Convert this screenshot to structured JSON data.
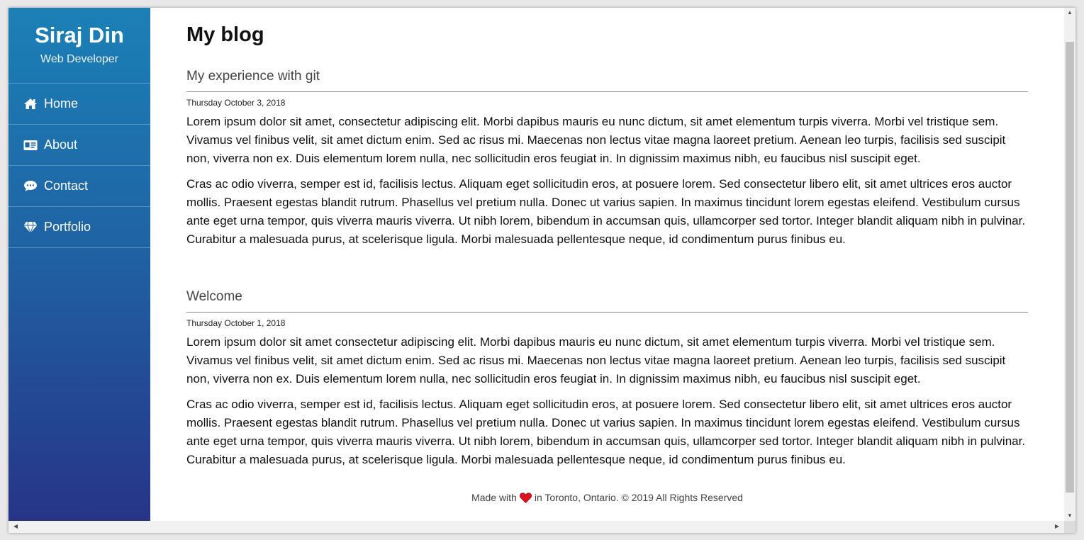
{
  "brand": {
    "name": "Siraj Din",
    "role": "Web Developer"
  },
  "nav": {
    "items": [
      {
        "label": "Home",
        "icon": "home-icon"
      },
      {
        "label": "About",
        "icon": "id-card-icon"
      },
      {
        "label": "Contact",
        "icon": "chat-icon"
      },
      {
        "label": "Portfolio",
        "icon": "diamond-icon"
      }
    ]
  },
  "page": {
    "title": "My blog"
  },
  "posts": [
    {
      "title": "My experience with git",
      "date": "Thursday October 3, 2018",
      "paragraphs": [
        "Lorem ipsum dolor sit amet, consectetur adipiscing elit. Morbi dapibus mauris eu nunc dictum, sit amet elementum turpis viverra. Morbi vel tristique sem. Vivamus vel finibus velit, sit amet dictum enim. Sed ac risus mi. Maecenas non lectus vitae magna laoreet pretium. Aenean leo turpis, facilisis sed suscipit non, viverra non ex. Duis elementum lorem nulla, nec sollicitudin eros feugiat in. In dignissim maximus nibh, eu faucibus nisl suscipit eget.",
        "Cras ac odio viverra, semper est id, facilisis lectus. Aliquam eget sollicitudin eros, at posuere lorem. Sed consectetur libero elit, sit amet ultrices eros auctor mollis. Praesent egestas blandit rutrum. Phasellus vel pretium nulla. Donec ut varius sapien. In maximus tincidunt lorem egestas eleifend. Vestibulum cursus ante eget urna tempor, quis viverra mauris viverra. Ut nibh lorem, bibendum in accumsan quis, ullamcorper sed tortor. Integer blandit aliquam nibh in pulvinar. Curabitur a malesuada purus, at scelerisque ligula. Morbi malesuada pellentesque neque, id condimentum purus finibus eu."
      ]
    },
    {
      "title": "Welcome",
      "date": "Thursday October 1, 2018",
      "paragraphs": [
        "Lorem ipsum dolor sit amet consectetur adipiscing elit. Morbi dapibus mauris eu nunc dictum, sit amet elementum turpis viverra. Morbi vel tristique sem. Vivamus vel finibus velit, sit amet dictum enim. Sed ac risus mi. Maecenas non lectus vitae magna laoreet pretium. Aenean leo turpis, facilisis sed suscipit non, viverra non ex. Duis elementum lorem nulla, nec sollicitudin eros feugiat in. In dignissim maximus nibh, eu faucibus nisl suscipit eget.",
        "Cras ac odio viverra, semper est id, facilisis lectus. Aliquam eget sollicitudin eros, at posuere lorem. Sed consectetur libero elit, sit amet ultrices eros auctor mollis. Praesent egestas blandit rutrum. Phasellus vel pretium nulla. Donec ut varius sapien. In maximus tincidunt lorem egestas eleifend. Vestibulum cursus ante eget urna tempor, quis viverra mauris viverra. Ut nibh lorem, bibendum in accumsan quis, ullamcorper sed tortor. Integer blandit aliquam nibh in pulvinar. Curabitur a malesuada purus, at scelerisque ligula. Morbi malesuada pellentesque neque, id condimentum purus finibus eu."
      ]
    }
  ],
  "footer": {
    "before_heart": "Made with",
    "after_heart": "in Toronto, Ontario. © 2019 All Rights Reserved",
    "heart_icon": "heart-icon"
  },
  "colors": {
    "sidebar_top": "#1b80b6",
    "sidebar_bottom": "#273487",
    "heart": "#e0121e"
  }
}
